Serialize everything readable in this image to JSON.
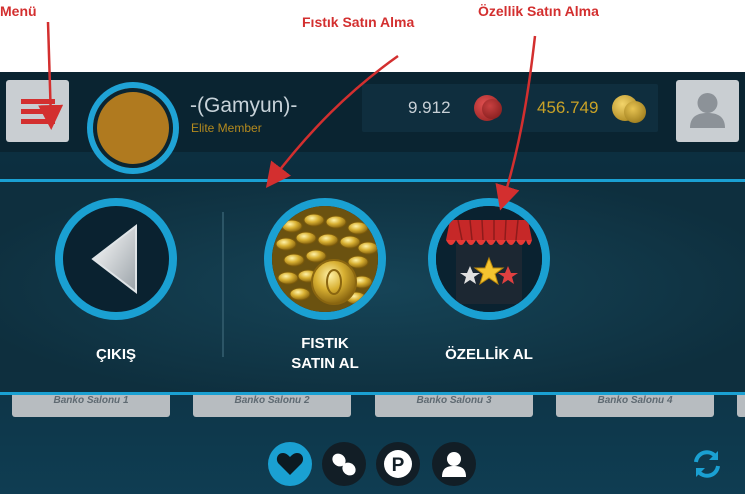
{
  "annotations": {
    "menu": "Menü",
    "buy_peanut": "Fıstık Satın Alma",
    "buy_feature": "Özellik Satın Alma"
  },
  "header": {
    "user_name": "-(Gamyun)-",
    "user_rank": "Elite Member",
    "currency_red": "9.912",
    "currency_gold": "456.749"
  },
  "panel": {
    "exit_label": "ÇIKIŞ",
    "peanut_label_line1": "FISTIK",
    "peanut_label_line2": "SATIN AL",
    "feature_label": "ÖZELLİK AL"
  },
  "tabs": [
    "Banko Salonu 1",
    "Banko Salonu 2",
    "Banko Salonu 3",
    "Banko Salonu 4"
  ],
  "bottom_nav": [
    "heart-icon",
    "peanut-icon",
    "parking-icon",
    "person-icon"
  ],
  "colors": {
    "accent": "#1aa0d2",
    "annotation_red": "#d32f2f",
    "gold": "#c9a227",
    "background": "#0b2a3a"
  }
}
